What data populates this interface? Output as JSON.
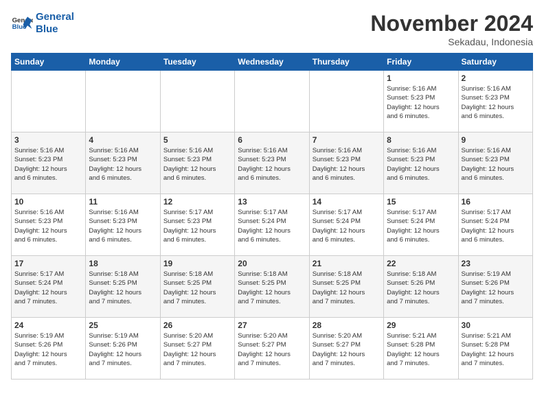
{
  "logo": {
    "line1": "General",
    "line2": "Blue"
  },
  "title": "November 2024",
  "subtitle": "Sekadau, Indonesia",
  "weekdays": [
    "Sunday",
    "Monday",
    "Tuesday",
    "Wednesday",
    "Thursday",
    "Friday",
    "Saturday"
  ],
  "weeks": [
    [
      {
        "day": "",
        "info": ""
      },
      {
        "day": "",
        "info": ""
      },
      {
        "day": "",
        "info": ""
      },
      {
        "day": "",
        "info": ""
      },
      {
        "day": "",
        "info": ""
      },
      {
        "day": "1",
        "info": "Sunrise: 5:16 AM\nSunset: 5:23 PM\nDaylight: 12 hours\nand 6 minutes."
      },
      {
        "day": "2",
        "info": "Sunrise: 5:16 AM\nSunset: 5:23 PM\nDaylight: 12 hours\nand 6 minutes."
      }
    ],
    [
      {
        "day": "3",
        "info": "Sunrise: 5:16 AM\nSunset: 5:23 PM\nDaylight: 12 hours\nand 6 minutes."
      },
      {
        "day": "4",
        "info": "Sunrise: 5:16 AM\nSunset: 5:23 PM\nDaylight: 12 hours\nand 6 minutes."
      },
      {
        "day": "5",
        "info": "Sunrise: 5:16 AM\nSunset: 5:23 PM\nDaylight: 12 hours\nand 6 minutes."
      },
      {
        "day": "6",
        "info": "Sunrise: 5:16 AM\nSunset: 5:23 PM\nDaylight: 12 hours\nand 6 minutes."
      },
      {
        "day": "7",
        "info": "Sunrise: 5:16 AM\nSunset: 5:23 PM\nDaylight: 12 hours\nand 6 minutes."
      },
      {
        "day": "8",
        "info": "Sunrise: 5:16 AM\nSunset: 5:23 PM\nDaylight: 12 hours\nand 6 minutes."
      },
      {
        "day": "9",
        "info": "Sunrise: 5:16 AM\nSunset: 5:23 PM\nDaylight: 12 hours\nand 6 minutes."
      }
    ],
    [
      {
        "day": "10",
        "info": "Sunrise: 5:16 AM\nSunset: 5:23 PM\nDaylight: 12 hours\nand 6 minutes."
      },
      {
        "day": "11",
        "info": "Sunrise: 5:16 AM\nSunset: 5:23 PM\nDaylight: 12 hours\nand 6 minutes."
      },
      {
        "day": "12",
        "info": "Sunrise: 5:17 AM\nSunset: 5:23 PM\nDaylight: 12 hours\nand 6 minutes."
      },
      {
        "day": "13",
        "info": "Sunrise: 5:17 AM\nSunset: 5:24 PM\nDaylight: 12 hours\nand 6 minutes."
      },
      {
        "day": "14",
        "info": "Sunrise: 5:17 AM\nSunset: 5:24 PM\nDaylight: 12 hours\nand 6 minutes."
      },
      {
        "day": "15",
        "info": "Sunrise: 5:17 AM\nSunset: 5:24 PM\nDaylight: 12 hours\nand 6 minutes."
      },
      {
        "day": "16",
        "info": "Sunrise: 5:17 AM\nSunset: 5:24 PM\nDaylight: 12 hours\nand 6 minutes."
      }
    ],
    [
      {
        "day": "17",
        "info": "Sunrise: 5:17 AM\nSunset: 5:24 PM\nDaylight: 12 hours\nand 7 minutes."
      },
      {
        "day": "18",
        "info": "Sunrise: 5:18 AM\nSunset: 5:25 PM\nDaylight: 12 hours\nand 7 minutes."
      },
      {
        "day": "19",
        "info": "Sunrise: 5:18 AM\nSunset: 5:25 PM\nDaylight: 12 hours\nand 7 minutes."
      },
      {
        "day": "20",
        "info": "Sunrise: 5:18 AM\nSunset: 5:25 PM\nDaylight: 12 hours\nand 7 minutes."
      },
      {
        "day": "21",
        "info": "Sunrise: 5:18 AM\nSunset: 5:25 PM\nDaylight: 12 hours\nand 7 minutes."
      },
      {
        "day": "22",
        "info": "Sunrise: 5:18 AM\nSunset: 5:26 PM\nDaylight: 12 hours\nand 7 minutes."
      },
      {
        "day": "23",
        "info": "Sunrise: 5:19 AM\nSunset: 5:26 PM\nDaylight: 12 hours\nand 7 minutes."
      }
    ],
    [
      {
        "day": "24",
        "info": "Sunrise: 5:19 AM\nSunset: 5:26 PM\nDaylight: 12 hours\nand 7 minutes."
      },
      {
        "day": "25",
        "info": "Sunrise: 5:19 AM\nSunset: 5:26 PM\nDaylight: 12 hours\nand 7 minutes."
      },
      {
        "day": "26",
        "info": "Sunrise: 5:20 AM\nSunset: 5:27 PM\nDaylight: 12 hours\nand 7 minutes."
      },
      {
        "day": "27",
        "info": "Sunrise: 5:20 AM\nSunset: 5:27 PM\nDaylight: 12 hours\nand 7 minutes."
      },
      {
        "day": "28",
        "info": "Sunrise: 5:20 AM\nSunset: 5:27 PM\nDaylight: 12 hours\nand 7 minutes."
      },
      {
        "day": "29",
        "info": "Sunrise: 5:21 AM\nSunset: 5:28 PM\nDaylight: 12 hours\nand 7 minutes."
      },
      {
        "day": "30",
        "info": "Sunrise: 5:21 AM\nSunset: 5:28 PM\nDaylight: 12 hours\nand 7 minutes."
      }
    ]
  ]
}
